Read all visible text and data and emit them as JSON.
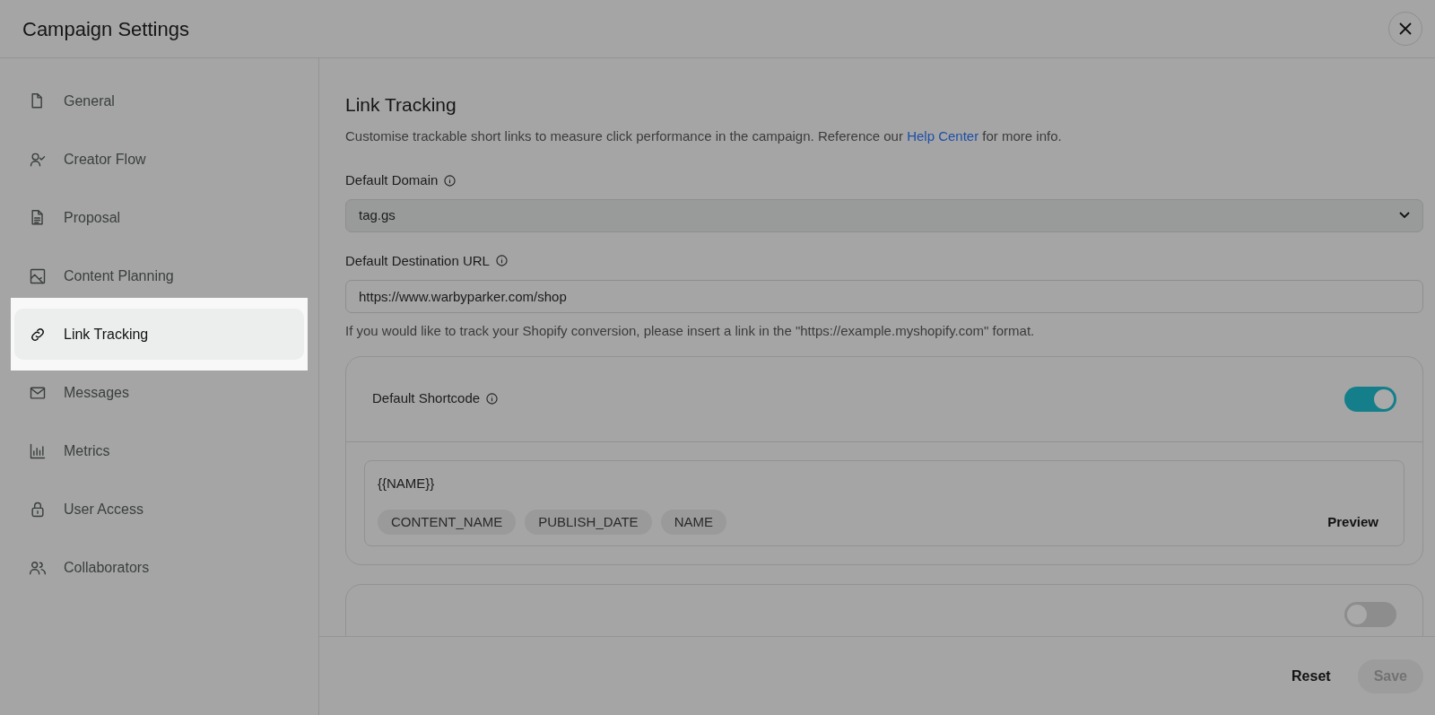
{
  "window": {
    "title": "Campaign Settings"
  },
  "sidebar": {
    "items": [
      {
        "label": "General",
        "selected": false
      },
      {
        "label": "Creator Flow",
        "selected": false
      },
      {
        "label": "Proposal",
        "selected": false
      },
      {
        "label": "Content Planning",
        "selected": false
      },
      {
        "label": "Link Tracking",
        "selected": true
      },
      {
        "label": "Messages",
        "selected": false
      },
      {
        "label": "Metrics",
        "selected": false
      },
      {
        "label": "User Access",
        "selected": false
      },
      {
        "label": "Collaborators",
        "selected": false
      }
    ]
  },
  "content": {
    "title": "Link Tracking",
    "description": {
      "before": "Customise trackable short links to measure click performance in the campaign. Reference our",
      "link": "Help Center",
      "after": "for more info."
    },
    "default_domain": {
      "label": "Default Domain",
      "value": "tag.gs"
    },
    "default_destination_url": {
      "label": "Default Destination URL",
      "value": "https://www.warbyparker.com/shop",
      "hint": "If you would like to track your Shopify conversion, please insert a link in the \"https://example.myshopify.com\" format."
    },
    "shortcode": {
      "label": "Default Shortcode",
      "on": true,
      "value": "{{NAME}}",
      "tags": [
        "CONTENT_NAME",
        "PUBLISH_DATE",
        "NAME"
      ],
      "preview": "Preview"
    },
    "utm": {
      "on": false
    }
  },
  "footer": {
    "buttons": [
      {
        "label": "Reset",
        "disabled": false
      },
      {
        "label": "Save",
        "disabled": true
      }
    ]
  }
}
